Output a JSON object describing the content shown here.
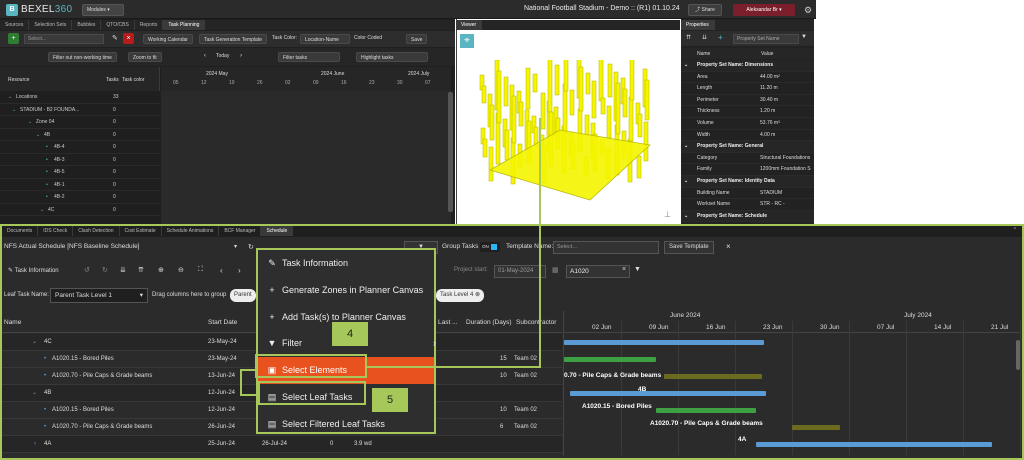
{
  "app": {
    "logo_text": "BEXEL",
    "logo_suffix": "360",
    "modules_label": "Modules",
    "project_title": "National Football Stadium - Demo :: (R1) 01.10.24",
    "share_label": "Share",
    "user_label": "Aleksandar Br"
  },
  "top_tabs": [
    "Sources",
    "Selection Sets",
    "Bubbles",
    "QTO/CBS",
    "Reports",
    "Task Planning"
  ],
  "task_toolbar": {
    "select_placeholder": "Select...",
    "working_calendar": "Working Calendar",
    "task_gen_template": "Task Generation Template",
    "task_color_label": "Task Color:",
    "task_color_value": "Location-Name",
    "color_coded": "Color Coded",
    "save": "Save"
  },
  "filter_toolbar": {
    "filter_nonworking": "Filter out non-working time",
    "zoom_fit": "Zoom to fit",
    "today": "Today",
    "filter_tasks": "Filter tasks",
    "highlight_tasks": "Highlight tasks"
  },
  "tree_header": {
    "resource": "Resource",
    "tasks": "Tasks",
    "task_color": "Task color"
  },
  "timeline_months": [
    "2024 May",
    "2024 June",
    "2024 July"
  ],
  "timeline_days": [
    "05",
    "12",
    "19",
    "26",
    "02",
    "09",
    "16",
    "23",
    "30",
    "07"
  ],
  "tree_rows": [
    {
      "label": "Locations",
      "count": "33"
    },
    {
      "label": "STADIUM - B2 FOUNDA...",
      "count": "0"
    },
    {
      "label": "Zone 04",
      "count": "0"
    },
    {
      "label": "4B",
      "count": "0"
    },
    {
      "label": "4B-4",
      "count": "0"
    },
    {
      "label": "4B-3",
      "count": "0"
    },
    {
      "label": "4B-5",
      "count": "0"
    },
    {
      "label": "4B-1",
      "count": "0"
    },
    {
      "label": "4B-2",
      "count": "0"
    },
    {
      "label": "4C",
      "count": "0"
    }
  ],
  "viewer": {
    "title": "Viewer"
  },
  "properties": {
    "title": "Properties",
    "search_placeholder": "Property Set Name",
    "col_name": "Name",
    "col_value": "Value",
    "groups": [
      {
        "name": "Property Set Name: Dimensions",
        "rows": [
          [
            "Area",
            "44.00 m²"
          ],
          [
            "Length",
            "11.20 m"
          ],
          [
            "Perimeter",
            "30.40 m"
          ],
          [
            "Thickness",
            "1.20 m"
          ],
          [
            "Volume",
            "53.76 m³"
          ],
          [
            "Width",
            "4.00 m"
          ]
        ]
      },
      {
        "name": "Property Set Name: General",
        "rows": [
          [
            "Category",
            "Structural Foundations"
          ],
          [
            "Family",
            "1200mm Foundation S"
          ]
        ]
      },
      {
        "name": "Property Set Name: Identity Data",
        "rows": [
          [
            "Building Name",
            "STADIUM"
          ],
          [
            "Workset Name",
            "STR - RC - FOUNDATIO"
          ]
        ]
      },
      {
        "name": "Property Set Name: Schedule",
        "rows": []
      }
    ]
  },
  "bottom_tabs": [
    "Documents",
    "IDS Check",
    "Clash Detection",
    "Cost Estimate",
    "Schedule Animations",
    "BCF Manager",
    "Schedule"
  ],
  "schedule_toolbar": {
    "schedule_name": "NFS Actual Schedule [NFS Baseline Schedule]",
    "delete": "Delete",
    "filter_label": "Filter Schedule",
    "group_tasks": "Group Tasks",
    "toggle_on": "ON",
    "template_name": "Template Name:",
    "template_placeholder": "Select...",
    "save_template": "Save Template"
  },
  "schedule_toolbar2": {
    "task_information": "Task Information",
    "project_start": "Project start:",
    "project_start_value": "01-May-2024",
    "search_value": "A1020"
  },
  "group_bar": {
    "label": "Leaf Task Name:",
    "parent_level": "Parent Task Level 1",
    "drag_hint": "Drag columns here to group",
    "chip_parent": "Parent",
    "chip_level4": "Task Level 4"
  },
  "grid_header": {
    "name": "Name",
    "start_date": "Start Date",
    "last": "Last ...",
    "duration": "Duration (Days)",
    "subcontractor": "Subcontractor"
  },
  "rows": [
    {
      "name": "4C",
      "start": "23-May-24",
      "dur": "",
      "sub": "",
      "group": true
    },
    {
      "name": "A1020.15 - Bored Piles",
      "start": "23-May-24",
      "dur": "15",
      "sub": "Team 02",
      "group": false
    },
    {
      "name": "A1020.70 - Pile Caps & Grade beams",
      "start": "13-Jun-24",
      "dur": "10",
      "sub": "Team 02",
      "group": false
    },
    {
      "name": "4B",
      "start": "12-Jun-24",
      "dur": "",
      "sub": "",
      "group": true
    },
    {
      "name": "A1020.15 - Bored Piles",
      "start": "12-Jun-24",
      "dur": "10",
      "sub": "Team 02",
      "group": false
    },
    {
      "name": "A1020.70 - Pile Caps & Grade beams",
      "start": "26-Jun-24",
      "dur": "6",
      "sub": "Team 02",
      "group": false
    },
    {
      "name": "4A",
      "start": "25-Jun-24",
      "finish": "26-Jul-24",
      "count": "0",
      "dur2": "3.9 wd",
      "group": true
    }
  ],
  "gantt": {
    "months": [
      "June 2024",
      "July 2024"
    ],
    "weeks": [
      "02 Jun",
      "09 Jun",
      "16 Jun",
      "23 Jun",
      "30 Jun",
      "07 Jul",
      "14 Jul",
      "21 Jul"
    ],
    "labels": [
      "0.70 - Pile Caps & Grade beams",
      "4B",
      "A1020.15 - Bored Piles",
      "A1020.70 - Pile Caps & Grade beams",
      "4A"
    ]
  },
  "context_menu": {
    "items": [
      "Task Information",
      "Generate Zones in Planner Canvas",
      "Add Task(s) to Planner Canvas",
      "Filter",
      "Select Elements",
      "Select Leaf Tasks",
      "Select Filtered Leaf Tasks"
    ]
  },
  "callouts": {
    "a": "4",
    "b": "5"
  },
  "colors": {
    "accent": "#5ab5c2",
    "highlight": "#e8521e",
    "callout": "#a6c85a",
    "bar_blue": "#5b9bd5",
    "bar_green": "#3da143",
    "bar_olive": "#6b6b1f"
  }
}
